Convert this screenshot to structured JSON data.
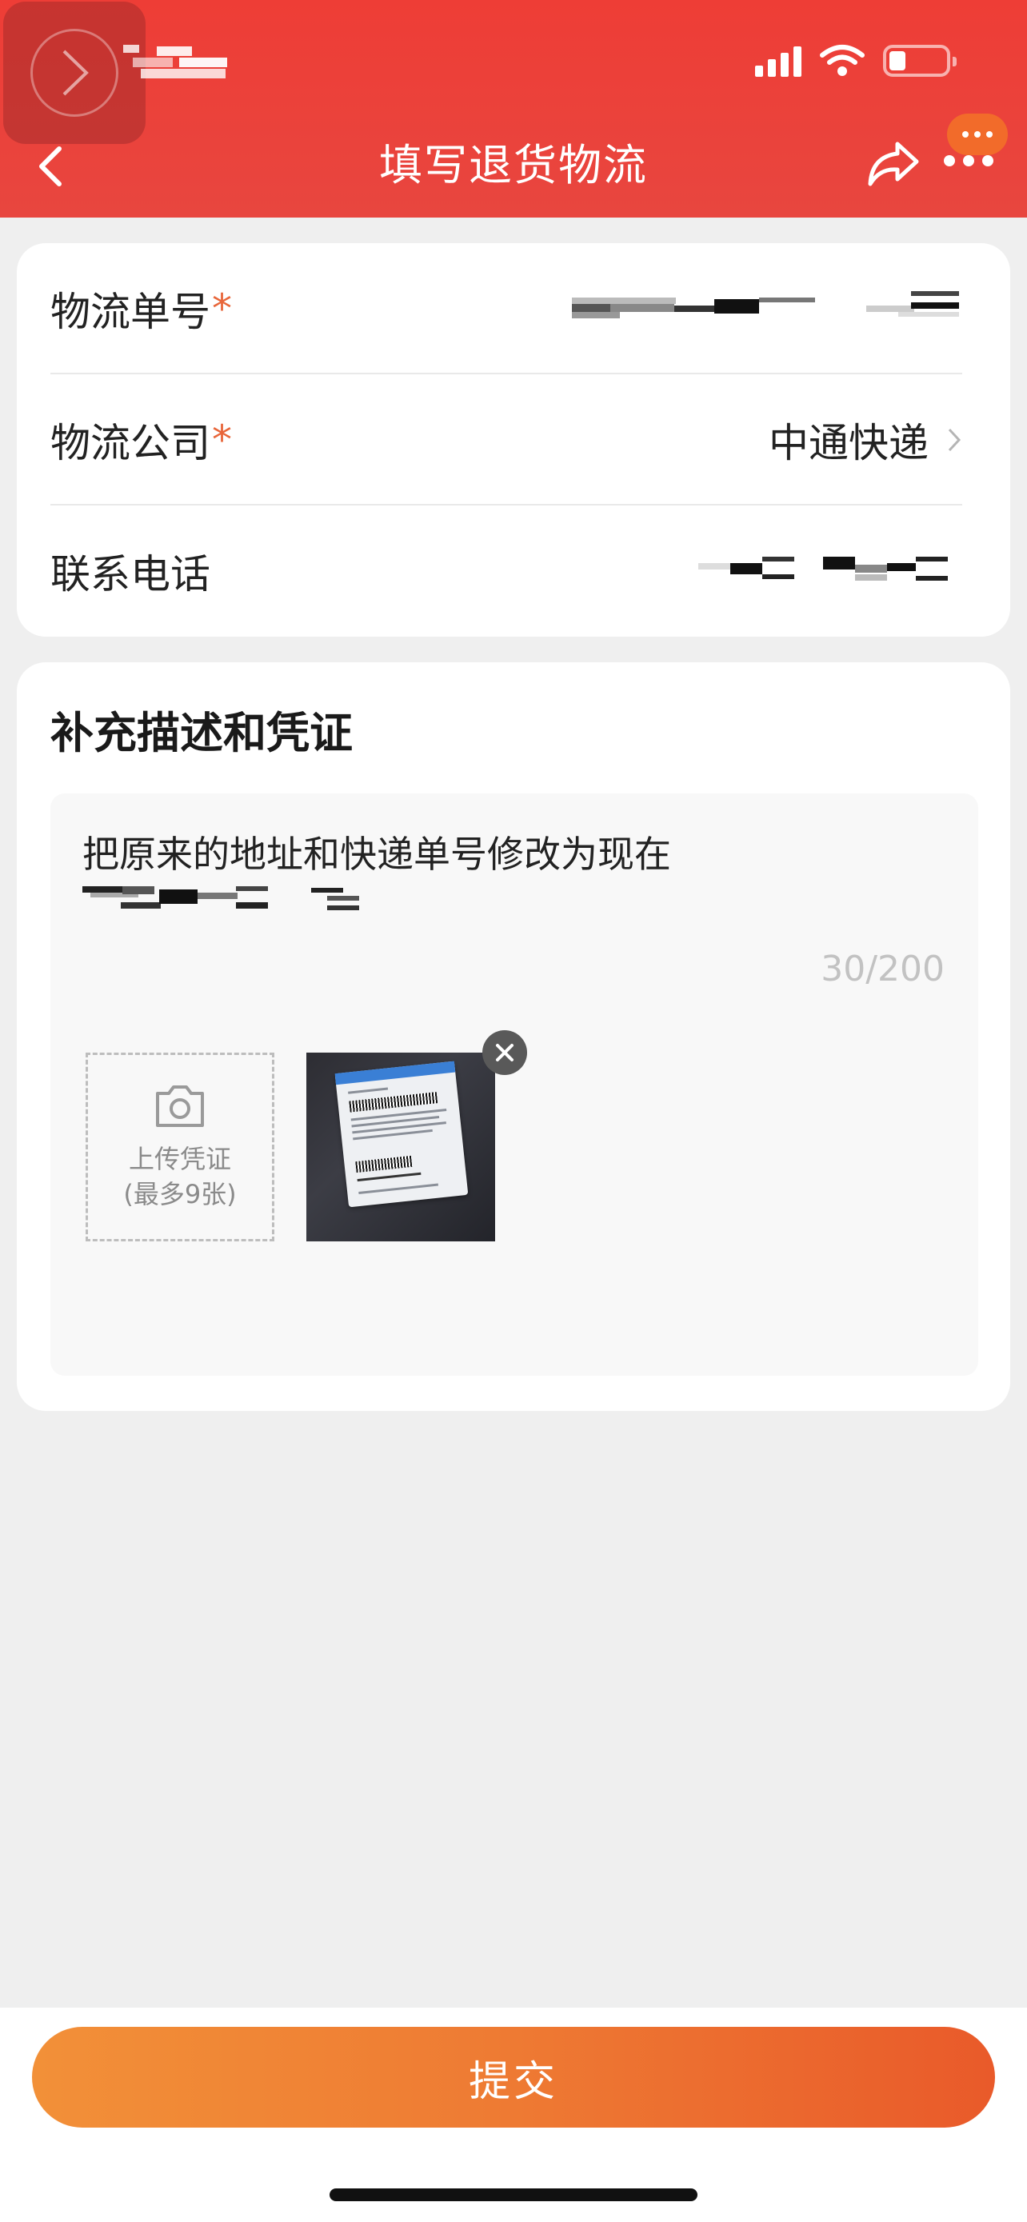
{
  "header": {
    "title": "填写退货物流",
    "background_color": "#ec3f38"
  },
  "form": {
    "tracking_number": {
      "label": "物流单号",
      "required_mark": "*"
    },
    "courier": {
      "label": "物流公司",
      "required_mark": "*",
      "value": "中通快递"
    },
    "phone": {
      "label": "联系电话"
    }
  },
  "description": {
    "title": "补充描述和凭证",
    "text": "把原来的地址和快递单号修改为现在",
    "counter": "30/200",
    "upload": {
      "line1": "上传凭证",
      "line2": "(最多9张)"
    }
  },
  "footer": {
    "submit_label": "提交"
  },
  "colors": {
    "accent": "#e8663a",
    "submit_start": "#f29038",
    "submit_end": "#e95a2a"
  },
  "icons": [
    "chevron-left-icon",
    "share-icon",
    "more-icon",
    "camera-icon",
    "close-icon",
    "chevron-right-icon",
    "wifi-icon",
    "signal-icon",
    "battery-icon"
  ]
}
